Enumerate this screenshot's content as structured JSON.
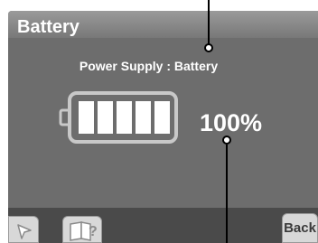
{
  "window": {
    "title": "Battery"
  },
  "status": {
    "text": "Power Supply : Battery"
  },
  "battery": {
    "level_percent": 100,
    "segments_filled": 5,
    "segments_total": 5,
    "percent_label": "100%"
  },
  "buttons": {
    "pointer_icon": "pointer-arrow-icon",
    "help_icon": "help-book-icon",
    "back_label": "Back"
  },
  "colors": {
    "screen_bg": "#6d6d6d",
    "title_bar": "#8a8a8a",
    "text": "#ffffff",
    "battery_outline": "#c8c8c8",
    "battery_segment": "#ffffff",
    "button_bg": "#d8d8d8"
  }
}
